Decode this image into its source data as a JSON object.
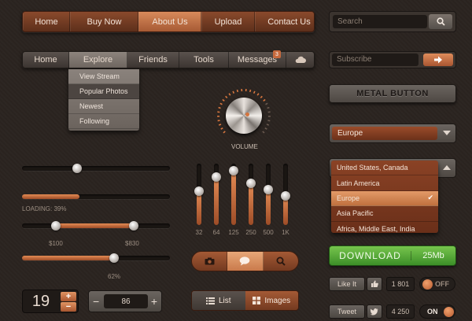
{
  "nav_primary": [
    {
      "label": "Home",
      "active": false
    },
    {
      "label": "Buy Now",
      "active": false
    },
    {
      "label": "About Us",
      "active": true
    },
    {
      "label": "Upload",
      "active": false
    },
    {
      "label": "Contact Us",
      "active": false
    }
  ],
  "nav_secondary": [
    {
      "label": "Home"
    },
    {
      "label": "Explore"
    },
    {
      "label": "Friends"
    },
    {
      "label": "Tools"
    },
    {
      "label": "Messages",
      "badge": "3"
    }
  ],
  "explore_menu": [
    "View Stream",
    "Popular Photos",
    "Newest",
    "Following"
  ],
  "search": {
    "placeholder": "Search"
  },
  "subscribe": {
    "placeholder": "Subscribe"
  },
  "metal_button": {
    "label": "METAL BUTTON"
  },
  "region_select": {
    "value": "Europe"
  },
  "region_list": {
    "options": [
      "United States, Canada",
      "Latin America",
      "Europe",
      "Asia Pacific",
      "Africa, Middle East, India"
    ],
    "selected": "Europe"
  },
  "download": {
    "label": "DOWNLOAD",
    "size": "25Mb"
  },
  "social": {
    "like_label": "Like It",
    "like_count": "1 801",
    "toggle1": "OFF",
    "tweet_label": "Tweet",
    "tweet_count": "4 250",
    "toggle2": "ON"
  },
  "sliders": {
    "loading_label": "LOADING: 39%",
    "loading_value": 0.39,
    "range_min_label": "$100",
    "range_max_label": "$830",
    "percent_label": "62%",
    "percent_value": 0.62
  },
  "volume": {
    "label": "VOLUME"
  },
  "equalizer": {
    "bands": [
      {
        "label": "32",
        "value": 0.55
      },
      {
        "label": "64",
        "value": 0.78
      },
      {
        "label": "125",
        "value": 0.88
      },
      {
        "label": "250",
        "value": 0.68
      },
      {
        "label": "500",
        "value": 0.58
      },
      {
        "label": "1K",
        "value": 0.48
      }
    ]
  },
  "view_toggle": {
    "list": "List",
    "images": "Images"
  },
  "number_spinner": {
    "value": "19"
  },
  "stepper": {
    "value": "86",
    "minus": "−",
    "plus": "+"
  },
  "colors": {
    "accent": "#c86a3d",
    "background": "#2b2420",
    "download": "#4ea834"
  }
}
